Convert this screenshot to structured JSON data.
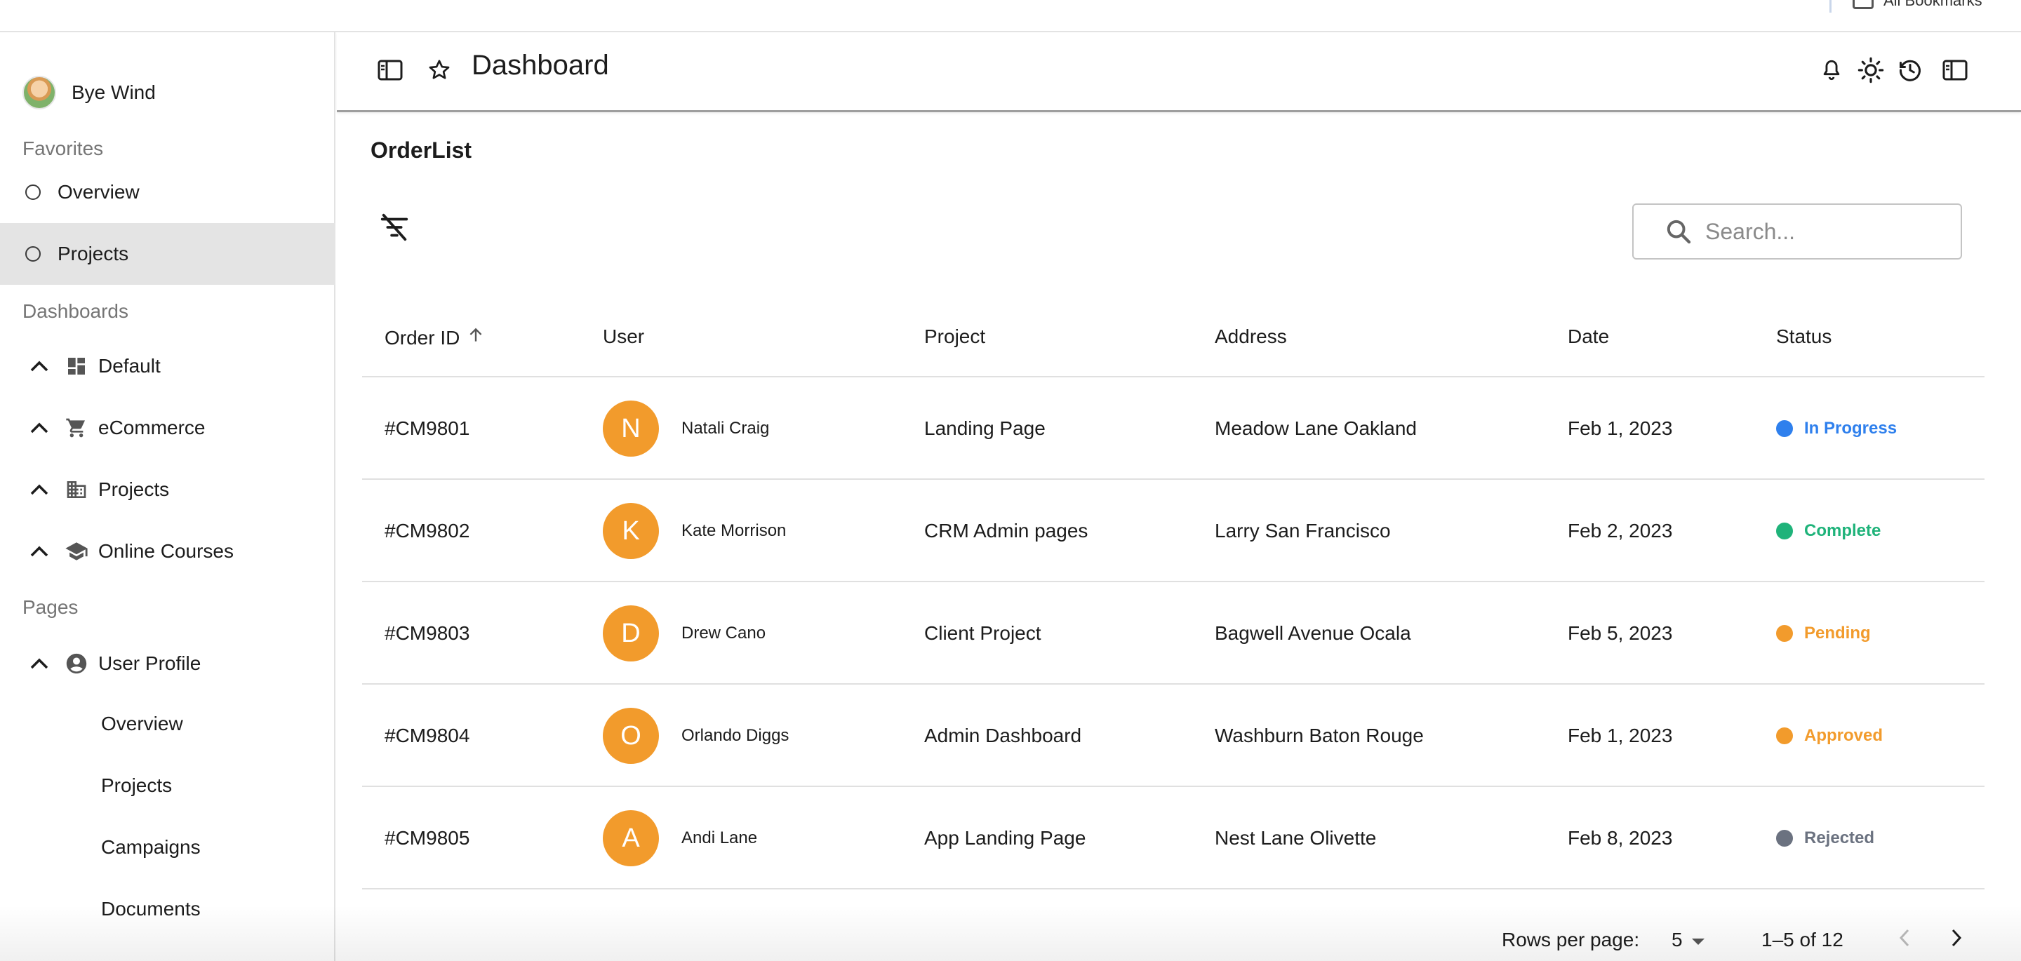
{
  "browser": {
    "bookmarks_label": "All Bookmarks"
  },
  "sidebar": {
    "user_name": "Bye Wind",
    "favorites_title": "Favorites",
    "favorites": [
      {
        "label": "Overview",
        "active": false
      },
      {
        "label": "Projects",
        "active": true
      }
    ],
    "dashboards_title": "Dashboards",
    "dashboards": [
      {
        "label": "Default",
        "icon": "dashboard-icon"
      },
      {
        "label": "eCommerce",
        "icon": "cart-icon"
      },
      {
        "label": "Projects",
        "icon": "building-icon"
      },
      {
        "label": "Online Courses",
        "icon": "school-icon"
      }
    ],
    "pages_title": "Pages",
    "pages": [
      {
        "label": "User Profile",
        "icon": "account-circle-icon"
      }
    ],
    "user_profile_children": [
      "Overview",
      "Projects",
      "Campaigns",
      "Documents"
    ]
  },
  "header": {
    "title": "Dashboard",
    "left_icons": [
      "sidebar-toggle-icon",
      "star-icon"
    ],
    "right_icons": [
      "bell-icon",
      "sun-icon",
      "history-icon",
      "panel-icon"
    ]
  },
  "main": {
    "title": "OrderList",
    "search": {
      "placeholder": "Search..."
    },
    "columns": [
      "Order ID",
      "User",
      "Project",
      "Address",
      "Date",
      "Status"
    ],
    "sort_column": "Order ID",
    "sort_direction": "ascending",
    "rows": [
      {
        "order_id": "#CM9801",
        "initial": "N",
        "user": "Natali Craig",
        "project": "Landing Page",
        "address": "Meadow Lane Oakland",
        "date": "Feb 1, 2023",
        "status": "In Progress",
        "status_color": "#2f80ed"
      },
      {
        "order_id": "#CM9802",
        "initial": "K",
        "user": "Kate Morrison",
        "project": "CRM Admin pages",
        "address": "Larry San Francisco",
        "date": "Feb 2, 2023",
        "status": "Complete",
        "status_color": "#1fb37a"
      },
      {
        "order_id": "#CM9803",
        "initial": "D",
        "user": "Drew Cano",
        "project": "Client Project",
        "address": "Bagwell Avenue Ocala",
        "date": "Feb 5, 2023",
        "status": "Pending",
        "status_color": "#f29b2c"
      },
      {
        "order_id": "#CM9804",
        "initial": "O",
        "user": "Orlando Diggs",
        "project": "Admin Dashboard",
        "address": "Washburn Baton Rouge",
        "date": "Feb 1, 2023",
        "status": "Approved",
        "status_color": "#f29b2c"
      },
      {
        "order_id": "#CM9805",
        "initial": "A",
        "user": "Andi Lane",
        "project": "App Landing Page",
        "address": "Nest Lane Olivette",
        "date": "Feb 8, 2023",
        "status": "Rejected",
        "status_color": "#6b7280"
      }
    ],
    "avatar_color": "#f29b2c",
    "pagination": {
      "rows_per_page_label": "Rows per page:",
      "rows_per_page": "5",
      "range": "1–5 of 12"
    }
  }
}
